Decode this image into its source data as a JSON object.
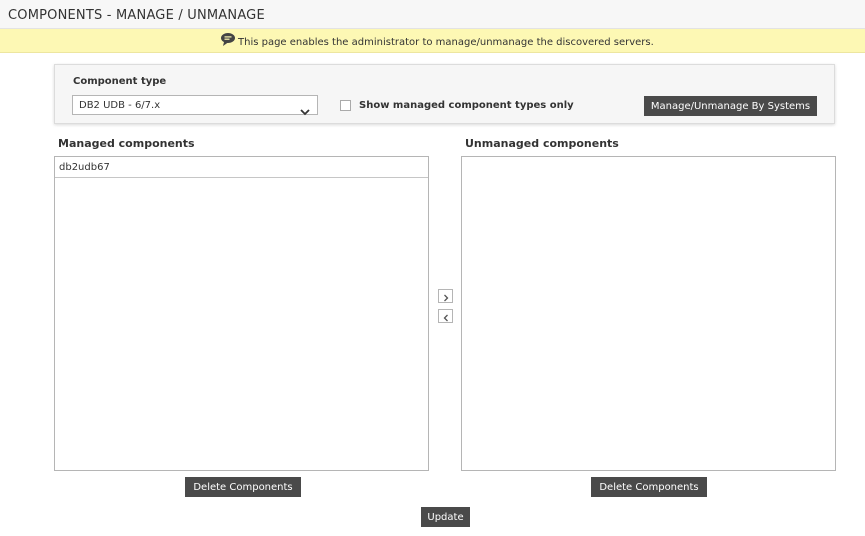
{
  "header": {
    "title": "COMPONENTS - MANAGE / UNMANAGE"
  },
  "info": {
    "icon": "chat-bubble-icon",
    "text": "This page enables the administrator to manage/unmanage the discovered servers."
  },
  "filter": {
    "component_type_label": "Component type",
    "component_type_value": "DB2 UDB - 6/7.x",
    "show_managed_label": "Show managed component types only",
    "show_managed_checked": false,
    "by_systems_button": "Manage/Unmanage By Systems"
  },
  "managed": {
    "title": "Managed components",
    "items": [
      "db2udb67"
    ],
    "delete_button": "Delete Components"
  },
  "unmanaged": {
    "title": "Unmanaged components",
    "items": [],
    "delete_button": "Delete Components"
  },
  "move_buttons": {
    "to_unmanaged_icon": "chevron-right-icon",
    "to_managed_icon": "chevron-left-icon"
  },
  "update_button": "Update",
  "colors": {
    "header_bg": "#f7f7f7",
    "info_bg": "#fdf8b4",
    "button_bg": "#4a4a4a"
  }
}
